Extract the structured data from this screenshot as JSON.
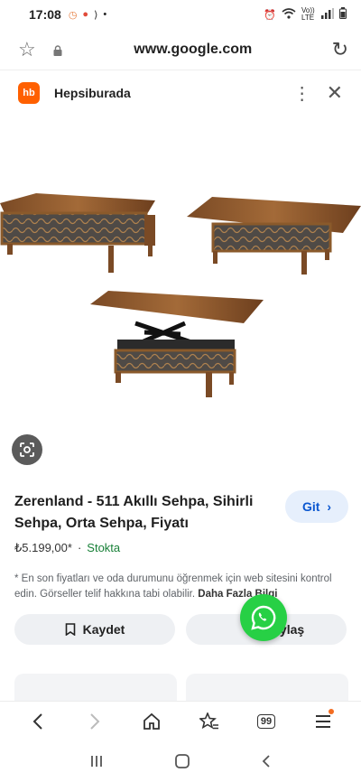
{
  "status_bar": {
    "time": "17:08",
    "network": "Vo)) LTE"
  },
  "url_bar": {
    "url": "www.google.com"
  },
  "source": {
    "logo_text": "hb",
    "name": "Hepsiburada"
  },
  "product": {
    "title": "Zerenland - 511 Akıllı Sehpa, Sihirli Sehpa, Orta Sehpa, Fiyatı",
    "price": "₺5.199,00*",
    "separator": "·",
    "stock": "Stokta",
    "disclaimer": "* En son fiyatları ve oda durumunu öğrenmek için web sitesini kontrol edin. Görseller telif hakkına tabi olabilir.",
    "more_link": "Daha Fazla Bilgi"
  },
  "buttons": {
    "go": "Git",
    "save": "Kaydet",
    "share": "Paylaş"
  },
  "browser_nav": {
    "tabs_count": "99"
  },
  "colors": {
    "brand": "#ff6000",
    "go_bg": "#e6effc",
    "link": "#0b57d0",
    "stock": "#188038",
    "whatsapp": "#27d045"
  }
}
